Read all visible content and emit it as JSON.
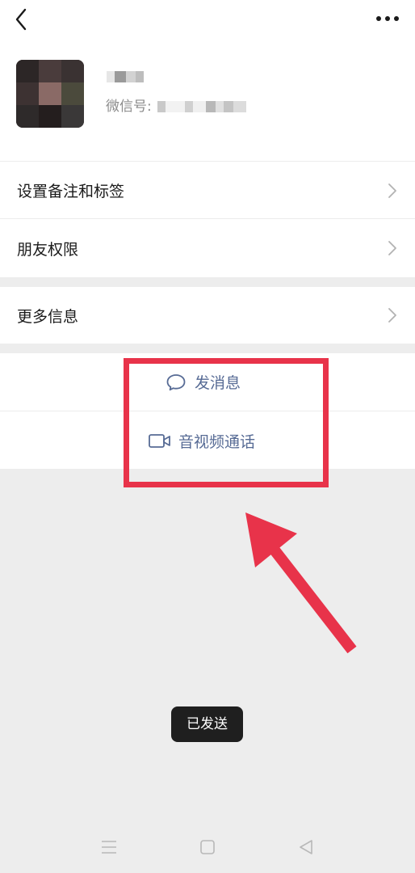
{
  "profile": {
    "wechat_id_label": "微信号:"
  },
  "menu": {
    "set_remark_label": "设置备注和标签",
    "friend_permissions_label": "朋友权限",
    "more_info_label": "更多信息"
  },
  "actions": {
    "send_message_label": "发消息",
    "video_call_label": "音视频通话"
  },
  "toast": {
    "text": "已发送"
  },
  "icons": {
    "back": "back-chevron-icon",
    "more": "more-dots-icon",
    "chevron": "chevron-right-icon",
    "message": "chat-bubble-icon",
    "video": "video-camera-icon",
    "nav_menu": "menu-lines-icon",
    "nav_home": "square-home-icon",
    "nav_back": "triangle-back-icon"
  },
  "colors": {
    "link": "#576b95",
    "highlight": "#e8334a",
    "background": "#ededed"
  }
}
